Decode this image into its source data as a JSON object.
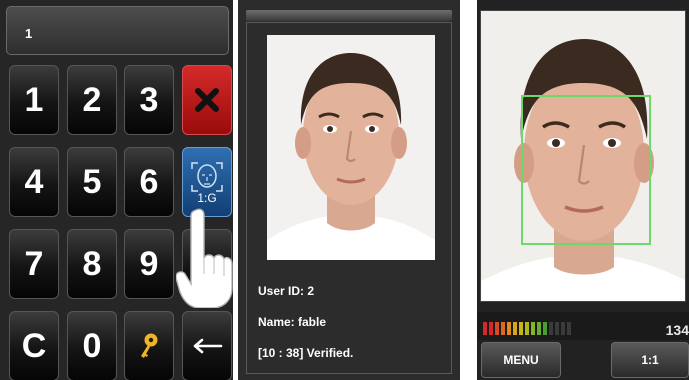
{
  "keypad": {
    "display_value": "1",
    "keys": {
      "k1": "1",
      "k2": "2",
      "k3": "3",
      "k4": "4",
      "k5": "5",
      "k6": "6",
      "k7": "7",
      "k8": "8",
      "k9": "9",
      "clear": "C",
      "k0": "0"
    },
    "face_key_label": "1:G",
    "icons": {
      "cancel": "x-icon",
      "face_verify": "face-scan-icon",
      "password": "key-icon",
      "backspace": "arrow-left-icon",
      "pointer": "hand-pointer-icon"
    },
    "colors": {
      "cancel": "#c81e1e",
      "face_key": "#1d5596"
    }
  },
  "verify": {
    "user_id": "User ID: 2",
    "name": "Name: fable",
    "status": "[10 : 38] Verified."
  },
  "camera": {
    "meter_count": "134",
    "menu_label": "MENU",
    "mode_label": "1:1",
    "colors": {
      "face_box": "#6fd86a"
    }
  }
}
